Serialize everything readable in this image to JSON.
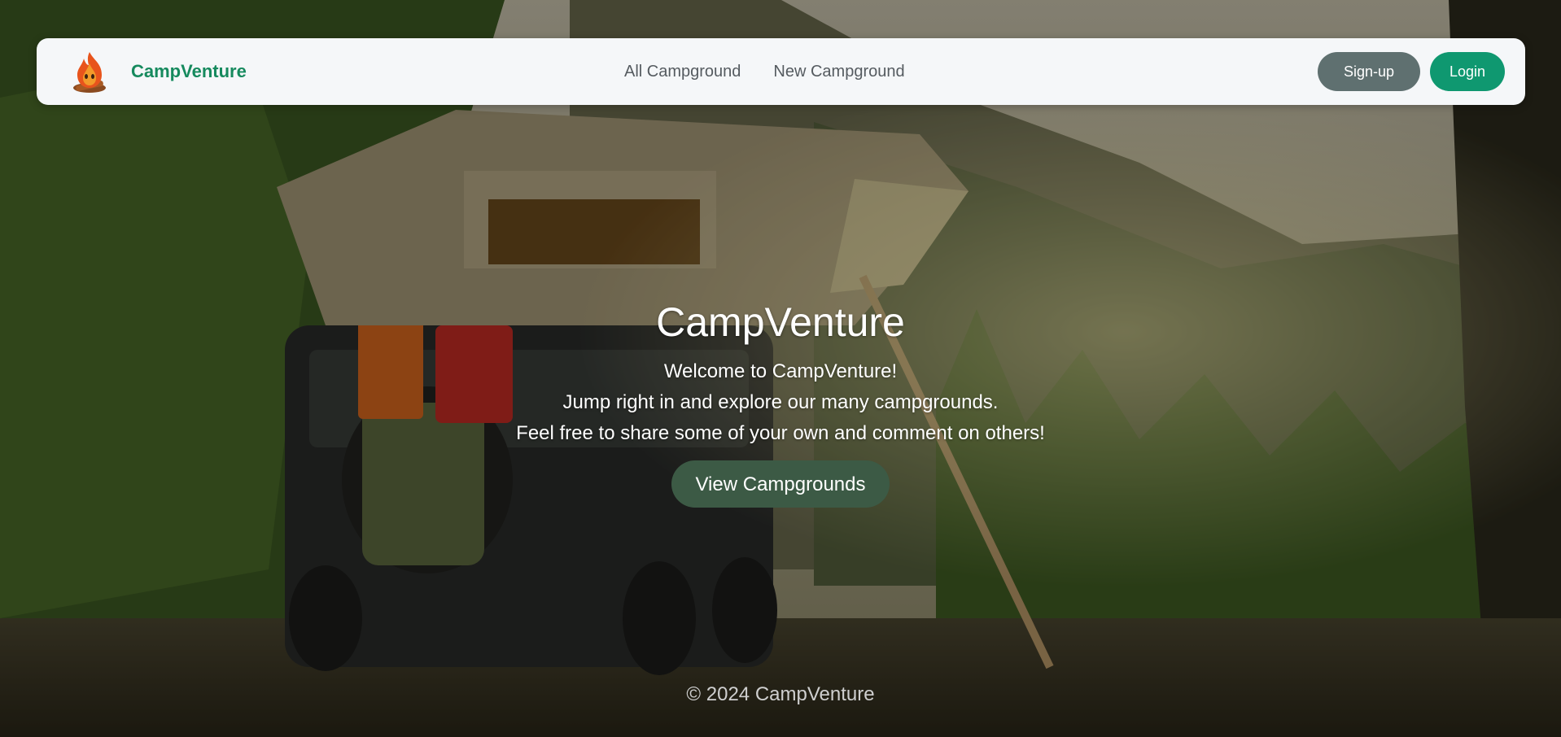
{
  "navbar": {
    "brand_name": "CampVenture",
    "links": [
      {
        "label": "All Campground"
      },
      {
        "label": "New Campground"
      }
    ],
    "signup_label": "Sign-up",
    "login_label": "Login"
  },
  "hero": {
    "title": "CampVenture",
    "lines": [
      "Welcome to CampVenture!",
      "Jump right in and explore our many campgrounds.",
      "Feel free to share some of your own and comment on others!"
    ],
    "cta_label": "View Campgrounds"
  },
  "footer": {
    "text": "© 2024 CampVenture"
  },
  "colors": {
    "brand_green": "#168a5e",
    "login_button": "#0f9870",
    "signup_button": "#5f7070",
    "hero_button": "#3c5a45",
    "navbar_bg": "#f5f7f9"
  },
  "icons": {
    "logo": "campfire-icon",
    "background": "campsite-photo"
  }
}
